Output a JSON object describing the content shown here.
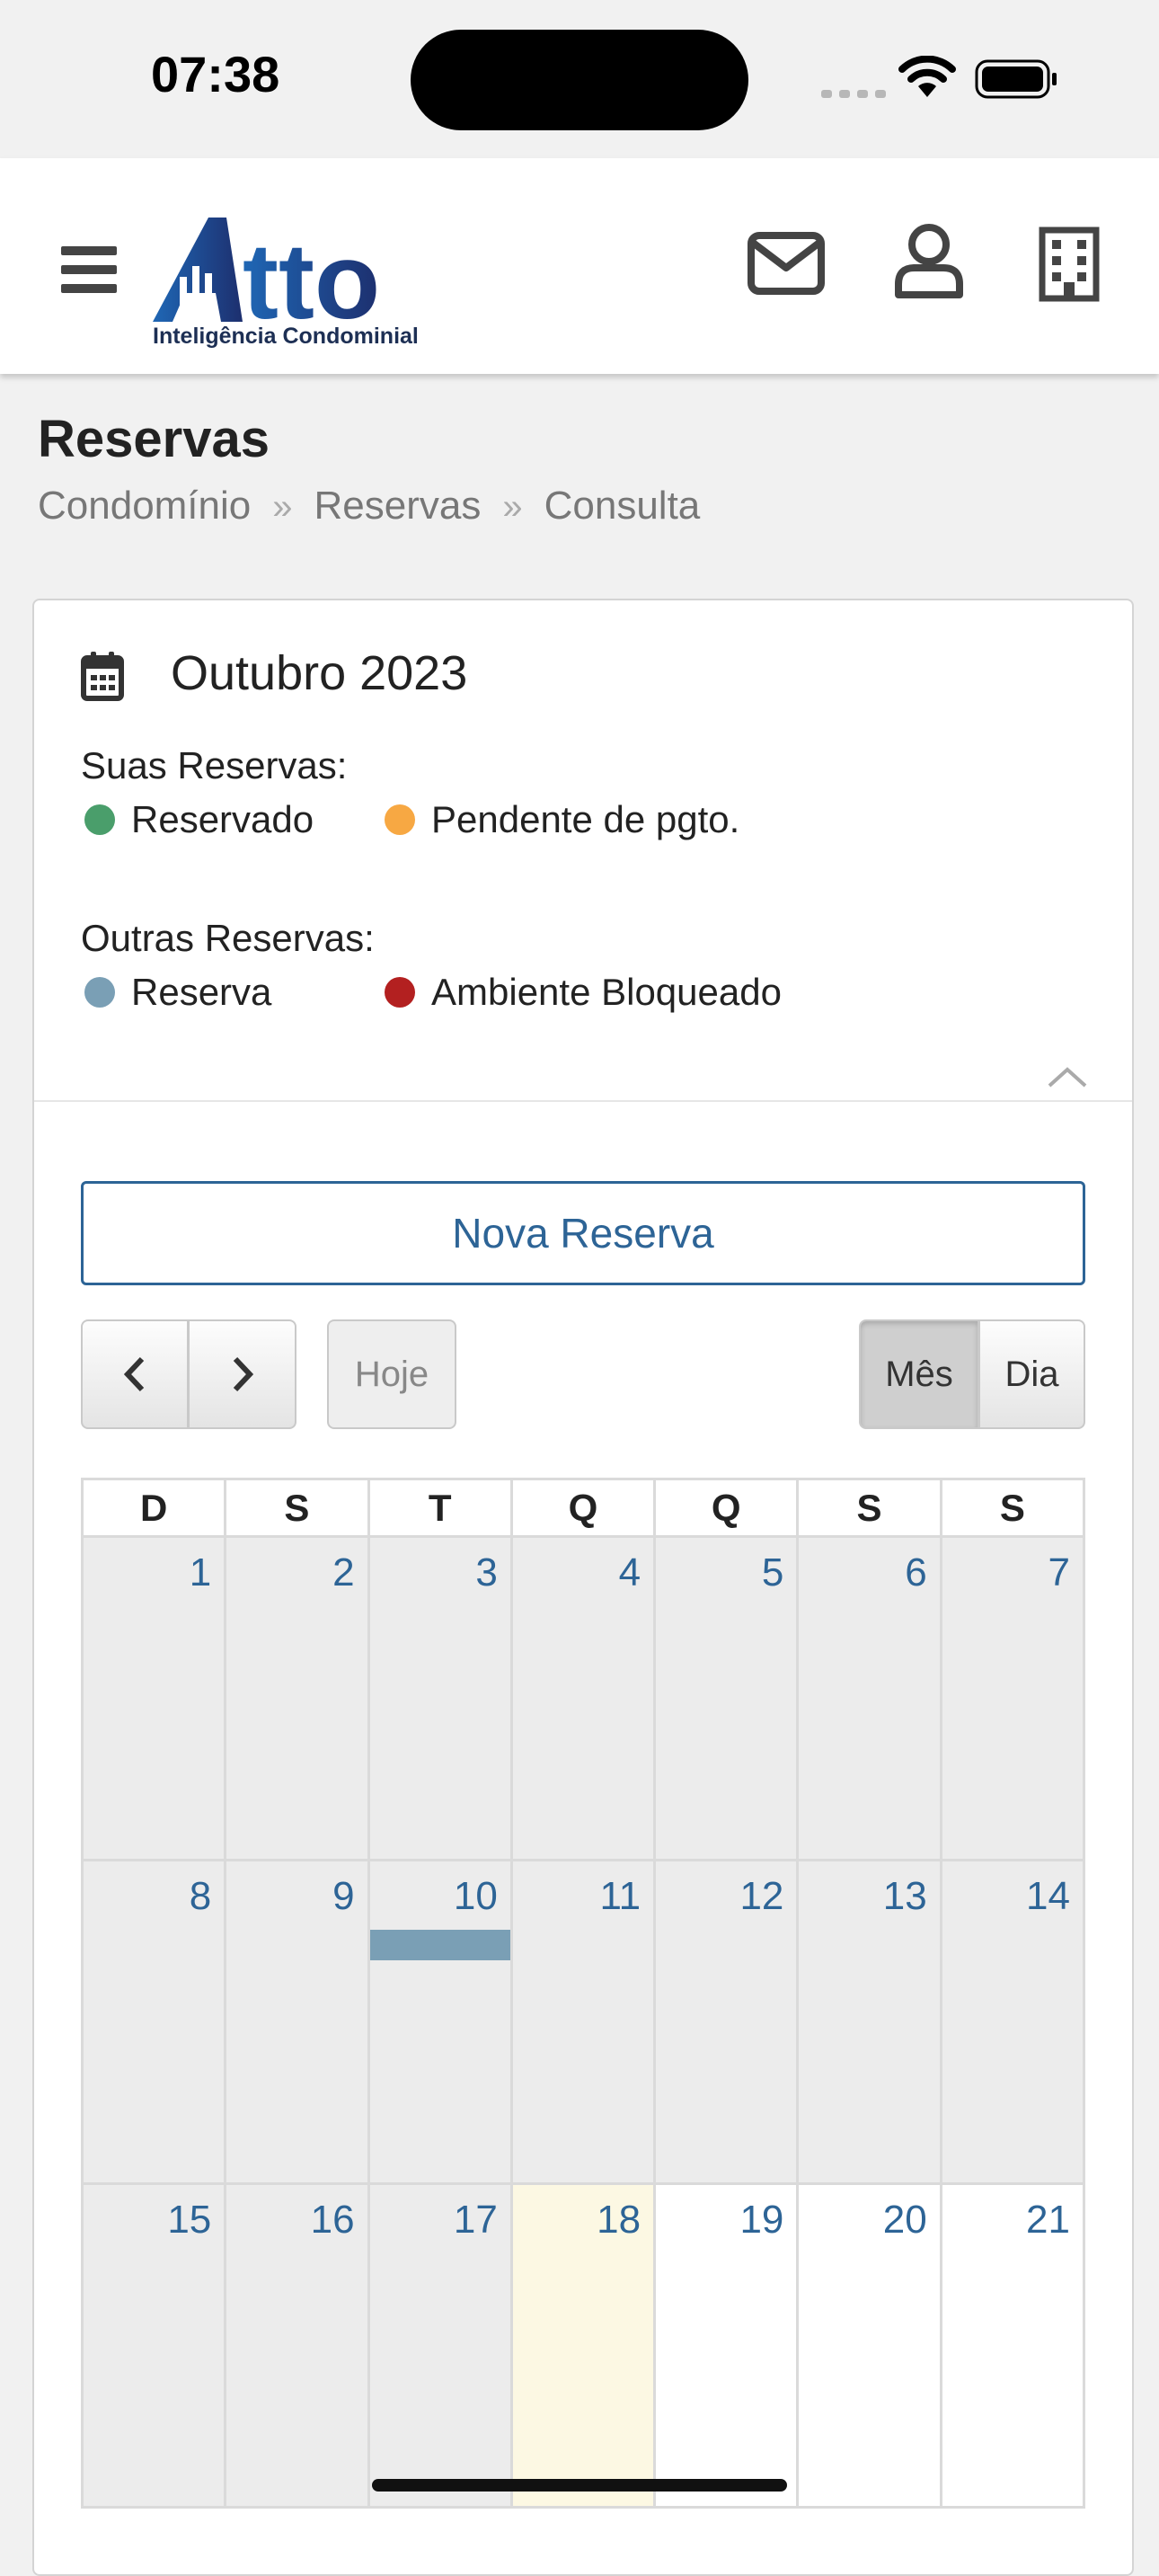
{
  "status_bar": {
    "time": "07:38"
  },
  "navbar": {
    "logo": {
      "word": "Atto",
      "tagline": "Inteligência Condominial"
    },
    "icons": [
      "menu-icon",
      "mail-icon",
      "user-icon",
      "building-icon"
    ]
  },
  "page": {
    "title": "Reservas",
    "breadcrumb": [
      "Condomínio",
      "Reservas",
      "Consulta"
    ]
  },
  "calendar_card": {
    "month_title": "Outubro 2023",
    "legend": {
      "own_heading": "Suas Reservas:",
      "own_items": [
        {
          "label": "Reservado",
          "color": "#4a9e6b"
        },
        {
          "label": "Pendente de pgto.",
          "color": "#f7a843"
        }
      ],
      "other_heading": "Outras Reservas:",
      "other_items": [
        {
          "label": "Reserva",
          "color": "#7a9fb5"
        },
        {
          "label": "Ambiente Bloqueado",
          "color": "#b32020"
        }
      ]
    },
    "new_booking_label": "Nova Reserva",
    "toolbar": {
      "today_label": "Hoje",
      "month_label": "Mês",
      "day_label": "Dia"
    },
    "weekdays": [
      "D",
      "S",
      "T",
      "Q",
      "Q",
      "S",
      "S"
    ],
    "weeks": [
      [
        "1",
        "2",
        "3",
        "4",
        "5",
        "6",
        "7"
      ],
      [
        "8",
        "9",
        "10",
        "11",
        "12",
        "13",
        "14"
      ],
      [
        "15",
        "16",
        "17",
        "18",
        "19",
        "20",
        "21"
      ]
    ],
    "today": "18",
    "events": [
      {
        "day": "10",
        "type": "Reserva",
        "color": "#7a9fb5"
      }
    ],
    "accent_color": "#2d6496"
  }
}
